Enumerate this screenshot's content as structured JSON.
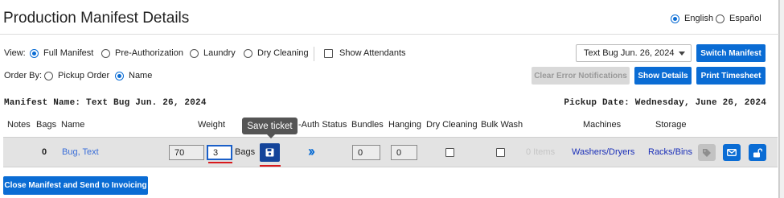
{
  "page": {
    "title": "Production Manifest Details"
  },
  "language": {
    "options": [
      {
        "label": "English",
        "selected": true
      },
      {
        "label": "Español",
        "selected": false
      }
    ]
  },
  "view": {
    "label": "View:",
    "options": [
      {
        "label": "Full Manifest",
        "selected": true
      },
      {
        "label": "Pre-Authorization",
        "selected": false
      },
      {
        "label": "Laundry",
        "selected": false
      },
      {
        "label": "Dry Cleaning",
        "selected": false
      }
    ],
    "show_attendants_label": "Show Attendants",
    "show_attendants_checked": false
  },
  "order_by": {
    "label": "Order By:",
    "options": [
      {
        "label": "Pickup Order",
        "selected": false
      },
      {
        "label": "Name",
        "selected": true
      }
    ]
  },
  "manifest_select": {
    "value": "Text Bug Jun. 26, 2024"
  },
  "buttons": {
    "switch_manifest": "Switch Manifest",
    "clear_errors": "Clear Error Notifications",
    "show_details": "Show Details",
    "print_timesheet": "Print Timesheet",
    "close_manifest": "Close Manifest and Send to Invoicing"
  },
  "manifest_info": {
    "name_line": "Manifest Name: Text Bug Jun. 26, 2024",
    "pickup_line": "Pickup Date: Wednesday, June 26, 2024"
  },
  "table": {
    "headers": {
      "notes": "Notes",
      "bags": "Bags",
      "name": "Name",
      "weight": "Weight",
      "auth_status": "-Auth Status",
      "bundles": "Bundles",
      "hanging": "Hanging",
      "dry_cleaning": "Dry Cleaning",
      "bulk_wash": "Bulk Wash",
      "machines": "Machines",
      "storage": "Storage"
    },
    "row": {
      "bags": "0",
      "name": "Bug, Text",
      "weight": "70",
      "bag_count": "3",
      "bags_unit": "Bags",
      "bundles": "0",
      "hanging": "0",
      "dry_cleaning_checked": false,
      "bulk_wash_checked": false,
      "items": "0 Items",
      "machines": "Washers/Dryers",
      "storage": "Racks/Bins"
    }
  },
  "tooltip": {
    "text": "Save ticket"
  },
  "icons": {
    "save": "floppy-disk-icon",
    "auth_advance": "double-chevron-right-icon",
    "tag": "tag-icon",
    "email": "envelope-icon",
    "unlock": "unlock-icon"
  },
  "colors": {
    "primary": "#0a6cd4",
    "save_button": "#14449a",
    "highlight": "#d8191c",
    "link": "#1a2fb8"
  }
}
